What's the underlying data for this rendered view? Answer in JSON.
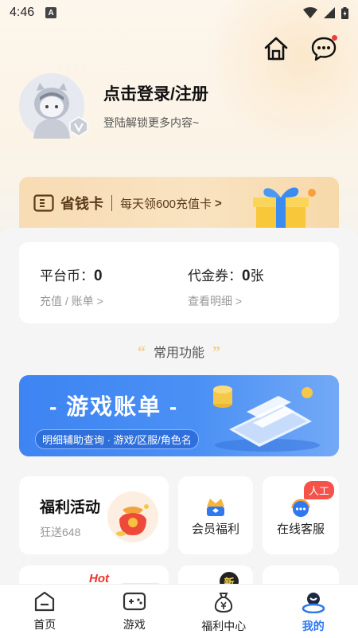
{
  "status_bar": {
    "time": "4:46",
    "notification_icon": "A"
  },
  "header": {
    "home_icon": "home-icon",
    "message_icon": "message-icon",
    "login_title": "点击登录/注册",
    "login_subtitle": "登陆解锁更多内容~"
  },
  "saving_card": {
    "title": "省钱卡",
    "subtitle": "每天领600充值卡",
    "arrow": ">"
  },
  "wallet": {
    "coin_label": "平台币：",
    "coin_value": "0",
    "coin_link": "充值 / 账单",
    "voucher_label": "代金券：",
    "voucher_value": "0",
    "voucher_unit": "张",
    "voucher_link": "查看明细",
    "chevron": ">"
  },
  "common_functions": {
    "title": "常用功能",
    "quote_left": "“",
    "quote_right": "”"
  },
  "banner": {
    "title": "- 游戏账单 -",
    "subtitle": "明细辅助查询 · 游戏/区服/角色名"
  },
  "tiles": {
    "welfare_title": "福利活动",
    "welfare_sub": "狂送648",
    "member_label": "会员福利",
    "service_label": "在线客服",
    "service_badge": "人工",
    "hot_label": "Hot",
    "new_label": "新"
  },
  "tabbar": {
    "items": [
      {
        "label": "首页",
        "icon": "home-tab-icon"
      },
      {
        "label": "游戏",
        "icon": "gamepad-icon"
      },
      {
        "label": "福利中心",
        "icon": "money-bag-icon"
      },
      {
        "label": "我的",
        "icon": "user-icon"
      }
    ],
    "active_index": 3
  },
  "colors": {
    "accent": "#2f78f0",
    "card_gold": "#f8dcb3",
    "banner_blue": "#3e84f3"
  }
}
